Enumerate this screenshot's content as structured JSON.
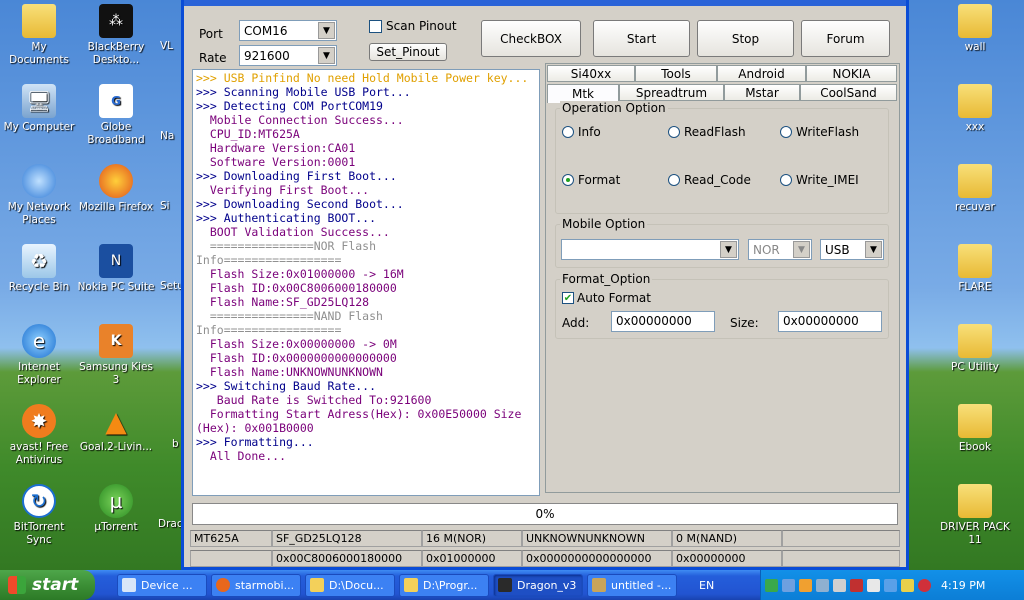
{
  "desktop": {
    "left_icons": [
      {
        "label": "My Documents",
        "icon": "folder-icon"
      },
      {
        "label": "BlackBerry Deskto...",
        "icon": "blackberry-icon"
      },
      {
        "label": "VL",
        "icon": "vlc-icon"
      },
      {
        "label": "My Computer",
        "icon": "computer-icon"
      },
      {
        "label": "Globe Broadband",
        "icon": "globe-icon"
      },
      {
        "label": "Na",
        "icon": "app-icon"
      },
      {
        "label": "My Network Places",
        "icon": "network-icon"
      },
      {
        "label": "Mozilla Firefox",
        "icon": "firefox-icon"
      },
      {
        "label": "Si",
        "icon": "app-icon"
      },
      {
        "label": "Recycle Bin",
        "icon": "recycle-bin-icon"
      },
      {
        "label": "Nokia PC Suite",
        "icon": "nokia-icon"
      },
      {
        "label": "Setu",
        "icon": "app-icon"
      },
      {
        "label": "Internet Explorer",
        "icon": "ie-icon"
      },
      {
        "label": "Samsung Kies 3",
        "icon": "kies-icon"
      },
      {
        "label": "avast! Free Antivirus",
        "icon": "avast-icon"
      },
      {
        "label": "Goal.2-Livin...",
        "icon": "vlc-icon"
      },
      {
        "label": "b",
        "icon": "app-icon"
      },
      {
        "label": "BitTorrent Sync",
        "icon": "bittorrent-icon"
      },
      {
        "label": "µTorrent",
        "icon": "utorrent-icon"
      },
      {
        "label": "Drac",
        "icon": "app-icon"
      }
    ],
    "right_icons": [
      {
        "label": "wall",
        "icon": "folder-icon"
      },
      {
        "label": "xxx",
        "icon": "folder-icon"
      },
      {
        "label": "recuvar",
        "icon": "folder-icon"
      },
      {
        "label": "FLARE",
        "icon": "folder-icon"
      },
      {
        "label": "PC Utility",
        "icon": "folder-icon"
      },
      {
        "label": "Ebook",
        "icon": "folder-icon"
      },
      {
        "label": "DRIVER PACK 11",
        "icon": "folder-icon"
      }
    ]
  },
  "app": {
    "port_label": "Port",
    "port_value": "COM16",
    "rate_label": "Rate",
    "rate_value": "921600",
    "scan_pinout_label": "Scan Pinout",
    "set_pinout_label": "Set_Pinout",
    "buttons": {
      "checkbox": "CheckBOX",
      "start": "Start",
      "stop": "Stop",
      "forum": "Forum"
    },
    "log_lines": [
      {
        "text": ">>> USB Pinfind No need Hold Mobile Power key...",
        "color": "yellow"
      },
      {
        "text": ">>> Scanning Mobile USB Port...",
        "color": "blue"
      },
      {
        "text": ">>> Detecting COM PortCOM19",
        "color": "blue"
      },
      {
        "text": "  Mobile Connection Success...",
        "color": "purple"
      },
      {
        "text": "  CPU_ID:MT625A",
        "color": "purple"
      },
      {
        "text": "  Hardware Version:CA01",
        "color": "purple"
      },
      {
        "text": "  Software Version:0001",
        "color": "purple"
      },
      {
        "text": ">>> Downloading First Boot...",
        "color": "blue"
      },
      {
        "text": "  Verifying First Boot...",
        "color": "purple"
      },
      {
        "text": ">>> Downloading Second Boot...",
        "color": "blue"
      },
      {
        "text": ">>> Authenticating BOOT...",
        "color": "blue"
      },
      {
        "text": "  BOOT Validation Success...",
        "color": "purple"
      },
      {
        "text": "  ===============NOR Flash",
        "color": "gray"
      },
      {
        "text": "Info=================",
        "color": "gray"
      },
      {
        "text": "  Flash Size:0x01000000 -> 16M",
        "color": "purple"
      },
      {
        "text": "  Flash ID:0x00C8006000180000",
        "color": "purple"
      },
      {
        "text": "  Flash Name:SF_GD25LQ128",
        "color": "purple"
      },
      {
        "text": "  ===============NAND Flash",
        "color": "gray"
      },
      {
        "text": "Info=================",
        "color": "gray"
      },
      {
        "text": "  Flash Size:0x00000000 -> 0M",
        "color": "purple"
      },
      {
        "text": "  Flash ID:0x0000000000000000",
        "color": "purple"
      },
      {
        "text": "  Flash Name:UNKNOWNUNKNOWN",
        "color": "purple"
      },
      {
        "text": ">>> Switching Baud Rate...",
        "color": "blue"
      },
      {
        "text": "   Baud Rate is Switched To:921600",
        "color": "purple"
      },
      {
        "text": "  Formatting Start Adress(Hex): 0x00E50000  Size",
        "color": "purple"
      },
      {
        "text": "(Hex): 0x001B0000",
        "color": "purple"
      },
      {
        "text": ">>> Formatting...",
        "color": "blue"
      },
      {
        "text": "  All Done...",
        "color": "purple"
      }
    ],
    "tabs_row1": [
      "Si40xx",
      "Tools",
      "Android",
      "NOKIA"
    ],
    "tabs_row2": [
      "Mtk",
      "Spreadtrum",
      "Mstar",
      "CoolSand"
    ],
    "active_tab": "Mtk",
    "operation_option": {
      "title": "Operation Option",
      "options": [
        "Info",
        "ReadFlash",
        "WriteFlash",
        "Format",
        "Read_Code",
        "Write_IMEI"
      ],
      "selected": "Format"
    },
    "mobile_option": {
      "title": "Mobile Option",
      "model_value": "",
      "memory_value": "NOR",
      "interface_value": "USB"
    },
    "format_option": {
      "title": "Format_Option",
      "auto_format_label": "Auto Format",
      "auto_format_checked": true,
      "add_label": "Add:",
      "add_value": "0x00000000",
      "size_label": "Size:",
      "size_value": "0x00000000"
    },
    "progress_text": "0%",
    "progress_fraction": 0,
    "status_row1": [
      "MT625A",
      "SF_GD25LQ128",
      "16 M(NOR)",
      "UNKNOWNUNKNOWN",
      "0 M(NAND)",
      ""
    ],
    "status_row2": [
      "",
      "0x00C8006000180000",
      "0x01000000",
      "0x0000000000000000",
      "0x00000000",
      ""
    ]
  },
  "taskbar": {
    "start_label": "start",
    "tasks": [
      "Device ...",
      "starmobi...",
      "D:\\Docu...",
      "D:\\Progr...",
      "Dragon_v3",
      "untitled -..."
    ],
    "active_task": "Dragon_v3",
    "language": "EN",
    "clock": "4:19 PM"
  },
  "colors": {
    "log_yellow": "#e0a000",
    "log_blue": "#00008b",
    "log_purple": "#7a007a",
    "window_frame": "#0a4cd6",
    "taskbar": "#245edb",
    "start_green": "#3c8f36"
  }
}
